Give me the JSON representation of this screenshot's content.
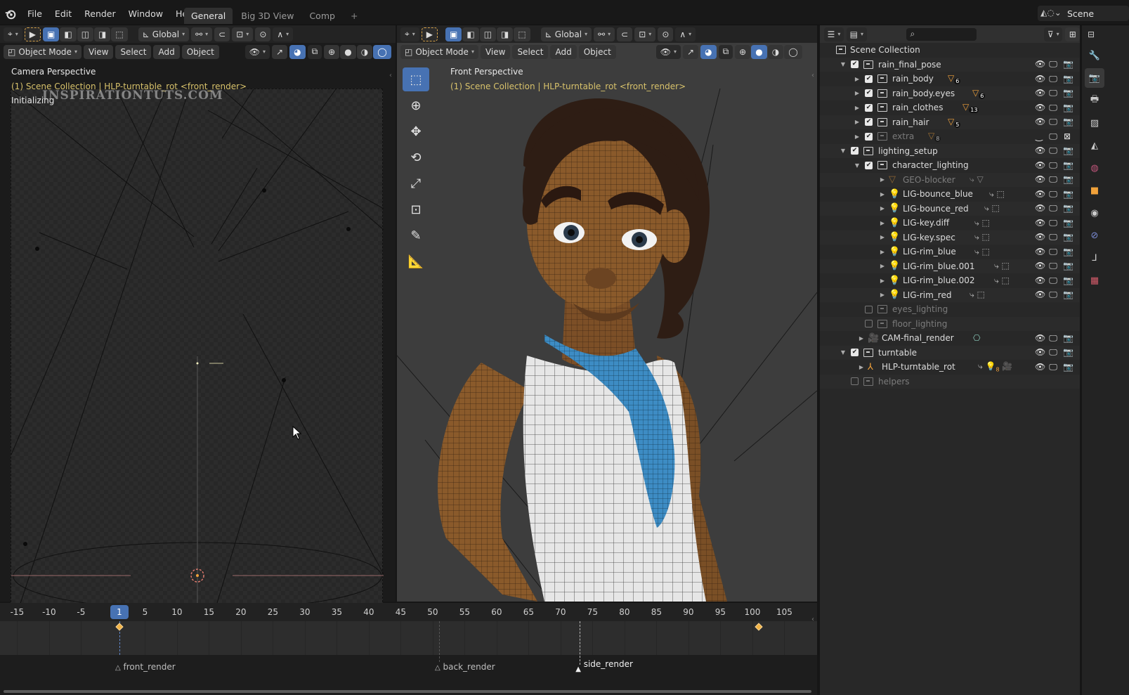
{
  "app": {
    "menu": [
      "File",
      "Edit",
      "Render",
      "Window",
      "Help"
    ],
    "workspace_tabs": [
      {
        "label": "General",
        "active": true
      },
      {
        "label": "Big 3D View",
        "active": false
      },
      {
        "label": "Comp",
        "active": false
      }
    ],
    "add_workspace": "+",
    "scene": "Scene"
  },
  "viewport_header": {
    "transform_orientation": "Global",
    "mode": "Object Mode",
    "menus": [
      "View",
      "Select",
      "Add",
      "Object"
    ]
  },
  "left_viewport": {
    "view_name": "Camera Perspective",
    "context": "(1) Scene Collection | HLP-turntable_rot <front_render>",
    "status": "Initializing",
    "watermark": "INSPIRATIONTUTS.COM"
  },
  "main_viewport": {
    "view_name": "Front Perspective",
    "context": "(1) Scene Collection | HLP-turntable_rot <front_render>",
    "tools": [
      "select-box",
      "cursor",
      "move",
      "rotate",
      "scale",
      "transform",
      "annotate",
      "measure"
    ]
  },
  "outliner": {
    "search_placeholder": "",
    "root": "Scene Collection",
    "rows": [
      {
        "label": "rain_final_pose",
        "depth": 0,
        "type": "collection",
        "expanded": true,
        "checked": true,
        "visible": true
      },
      {
        "label": "rain_body",
        "depth": 1,
        "type": "collection",
        "expanded": false,
        "checked": true,
        "badge": "6",
        "visible": true
      },
      {
        "label": "rain_body.eyes",
        "depth": 1,
        "type": "collection",
        "expanded": false,
        "checked": true,
        "badge": "6",
        "visible": true
      },
      {
        "label": "rain_clothes",
        "depth": 1,
        "type": "collection",
        "expanded": false,
        "checked": true,
        "badge": "13",
        "visible": true
      },
      {
        "label": "rain_hair",
        "depth": 1,
        "type": "collection",
        "expanded": false,
        "checked": true,
        "badge": "5",
        "visible": true
      },
      {
        "label": "extra",
        "depth": 1,
        "type": "collection",
        "expanded": false,
        "checked": true,
        "badge": "8",
        "visible": false,
        "dim": true
      },
      {
        "label": "lighting_setup",
        "depth": 0,
        "type": "collection",
        "expanded": true,
        "checked": true,
        "visible": true
      },
      {
        "label": "character_lighting",
        "depth": 1,
        "type": "collection",
        "expanded": true,
        "checked": true,
        "visible": true
      },
      {
        "label": "GEO-blocker",
        "depth": 2,
        "type": "mesh",
        "dim": true,
        "visible": true
      },
      {
        "label": "LIG-bounce_blue",
        "depth": 2,
        "type": "light",
        "visible": true
      },
      {
        "label": "LIG-bounce_red",
        "depth": 2,
        "type": "light",
        "visible": true
      },
      {
        "label": "LIG-key.diff",
        "depth": 2,
        "type": "light",
        "visible": true
      },
      {
        "label": "LIG-key.spec",
        "depth": 2,
        "type": "light",
        "visible": true
      },
      {
        "label": "LIG-rim_blue",
        "depth": 2,
        "type": "light",
        "visible": true
      },
      {
        "label": "LIG-rim_blue.001",
        "depth": 2,
        "type": "light",
        "visible": true
      },
      {
        "label": "LIG-rim_blue.002",
        "depth": 2,
        "type": "light",
        "visible": true
      },
      {
        "label": "LIG-rim_red",
        "depth": 2,
        "type": "light",
        "visible": true
      },
      {
        "label": "eyes_lighting",
        "depth": 1,
        "type": "collection",
        "checked": false,
        "dim": true,
        "novis": true
      },
      {
        "label": "floor_lighting",
        "depth": 1,
        "type": "collection",
        "checked": false,
        "dim": true,
        "novis": true
      },
      {
        "label": "CAM-final_render",
        "depth": 0.5,
        "type": "camera",
        "visible": true
      },
      {
        "label": "turntable",
        "depth": 0,
        "type": "collection",
        "expanded": true,
        "checked": true,
        "visible": true
      },
      {
        "label": "HLP-turntable_rot",
        "depth": 0.5,
        "type": "empty",
        "badge": "8",
        "visible": true
      },
      {
        "label": "helpers",
        "depth": 0,
        "type": "collection",
        "checked": false,
        "dim": true,
        "novis": true
      }
    ]
  },
  "properties_tabs": [
    "tool",
    "render",
    "output",
    "view-layer",
    "scene",
    "world",
    "object",
    "physics",
    "constraints",
    "data",
    "texture"
  ],
  "timeline": {
    "current_frame": "1",
    "ticks": [
      "-15",
      "-10",
      "-5",
      "5",
      "10",
      "15",
      "20",
      "25",
      "30",
      "35",
      "40",
      "45",
      "50",
      "55",
      "60",
      "65",
      "70",
      "75",
      "80",
      "85",
      "90",
      "95",
      "100",
      "105"
    ],
    "keyframes": [
      1,
      101
    ],
    "markers": [
      {
        "label": "front_render",
        "frame": 1,
        "selected": false
      },
      {
        "label": "back_render",
        "frame": 51,
        "selected": false
      },
      {
        "label": "side_render",
        "frame": 73,
        "selected": true
      }
    ]
  }
}
